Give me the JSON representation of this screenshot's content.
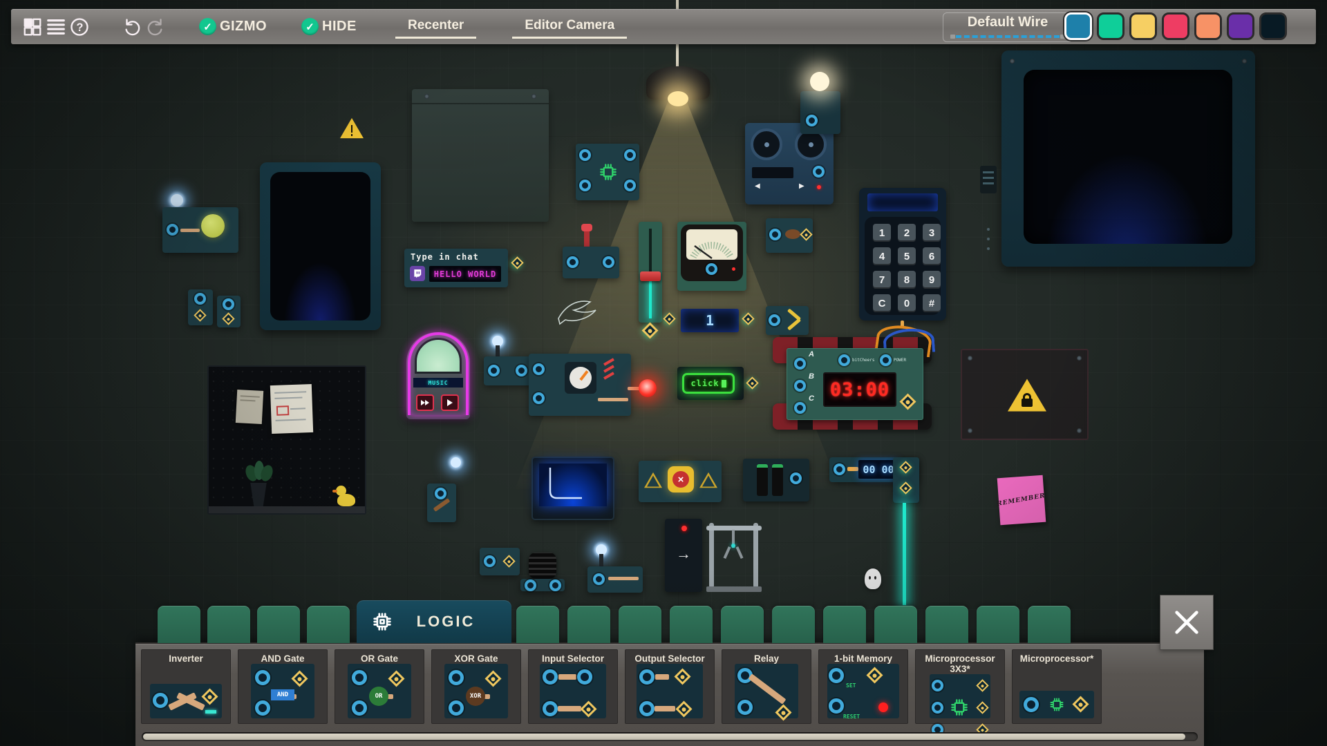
{
  "toolbar": {
    "icons": [
      "grid-menu-icon",
      "list-menu-icon",
      "help-icon",
      "undo-icon",
      "redo-icon"
    ],
    "toggles": [
      {
        "label": "GIZMO",
        "checked": true,
        "check_glyph": "✓"
      },
      {
        "label": "HIDE",
        "checked": true,
        "check_glyph": "✓"
      }
    ],
    "recenter_label": "Recenter",
    "editor_camera_label": "Editor Camera",
    "wire_selector_label": "Default Wire",
    "wire_colors": [
      {
        "name": "blue",
        "hex": "#1e80aa",
        "selected": true
      },
      {
        "name": "green",
        "hex": "#0fce99",
        "selected": false
      },
      {
        "name": "yellow",
        "hex": "#f6cf63",
        "selected": false
      },
      {
        "name": "red",
        "hex": "#ee3d63",
        "selected": false
      },
      {
        "name": "orange",
        "hex": "#f79266",
        "selected": false
      },
      {
        "name": "purple",
        "hex": "#6a2fa9",
        "selected": false
      },
      {
        "name": "dark-navy",
        "hex": "#081a24",
        "selected": false
      }
    ]
  },
  "canvas": {
    "chat_sign": {
      "title": "Type in chat",
      "display": "HELLO WORLD",
      "icon": "twitch-icon"
    },
    "click_button": {
      "label": "click"
    },
    "bomb": {
      "ports": [
        "A",
        "B",
        "C"
      ],
      "top_labels": [
        "bitCheers",
        "POWER"
      ],
      "display": "03:00"
    },
    "keypad": {
      "keys": [
        "1",
        "2",
        "3",
        "4",
        "5",
        "6",
        "7",
        "8",
        "9",
        "C",
        "0",
        "#"
      ]
    },
    "number_display": {
      "value": "1"
    },
    "counter_display": {
      "value": "00 00"
    },
    "jukebox": {
      "display": "MUSIC"
    },
    "sticky_note": {
      "text": "REMEMBER"
    },
    "arrow_board": {
      "glyph": "→"
    },
    "accent_colors": {
      "laser": "#1fe8cc",
      "neon_green": "#3ce03e",
      "neon_magenta": "#e73ae8",
      "led_blue": "#d6ecff",
      "warning_yellow": "#eec233"
    }
  },
  "bottom_panel": {
    "tabs_left": [
      {
        "name": "favorites-tab",
        "icon": "star-icon"
      },
      {
        "name": "hand-tab",
        "icon": "hand-tap-icon"
      },
      {
        "name": "light-tab",
        "icon": "sun-icon"
      },
      {
        "name": "toolbox-tab",
        "icon": "toolbox-icon"
      }
    ],
    "active_tab": {
      "label": "LOGIC",
      "icon": "chip-icon"
    },
    "tabs_right": [
      {
        "name": "fullscreen-tab",
        "icon": "fullscreen-icon"
      },
      {
        "name": "hidden-tab",
        "icon": "eye-off-icon"
      },
      {
        "name": "image-tab",
        "icon": "image-icon"
      },
      {
        "name": "coffee-tab",
        "icon": "coffee-icon"
      },
      {
        "name": "text-tab",
        "icon": "text-icon"
      },
      {
        "name": "robot-tab",
        "icon": "robot-icon"
      },
      {
        "name": "network-tab",
        "icon": "router-icon"
      },
      {
        "name": "hash-tab",
        "icon": "hash-icon"
      },
      {
        "name": "video-tab",
        "icon": "video-icon"
      },
      {
        "name": "server-tab",
        "icon": "server-icon"
      },
      {
        "name": "music-tab",
        "icon": "music-icon"
      }
    ],
    "components": [
      {
        "name": "Inverter",
        "preview": "inverter"
      },
      {
        "name": "AND Gate",
        "preview": "gate",
        "badge": "AND",
        "badge_color": "#2f7fd4",
        "badge_shape": "rect"
      },
      {
        "name": "OR Gate",
        "preview": "gate",
        "badge": "OR",
        "badge_color": "#2c7c38",
        "badge_shape": "circle"
      },
      {
        "name": "XOR Gate",
        "preview": "gate",
        "badge": "XOR",
        "badge_color": "#5c3a20",
        "badge_shape": "circle"
      },
      {
        "name": "Input Selector",
        "preview": "input-selector"
      },
      {
        "name": "Output Selector",
        "preview": "output-selector"
      },
      {
        "name": "Relay",
        "preview": "relay"
      },
      {
        "name": "1-bit Memory",
        "preview": "memory",
        "labels": [
          "SET",
          "RESET"
        ]
      },
      {
        "name": "Microprocessor 3X3*",
        "preview": "micro3"
      },
      {
        "name": "Microprocessor*",
        "preview": "micro1"
      }
    ],
    "close_icon": "close-icon"
  }
}
